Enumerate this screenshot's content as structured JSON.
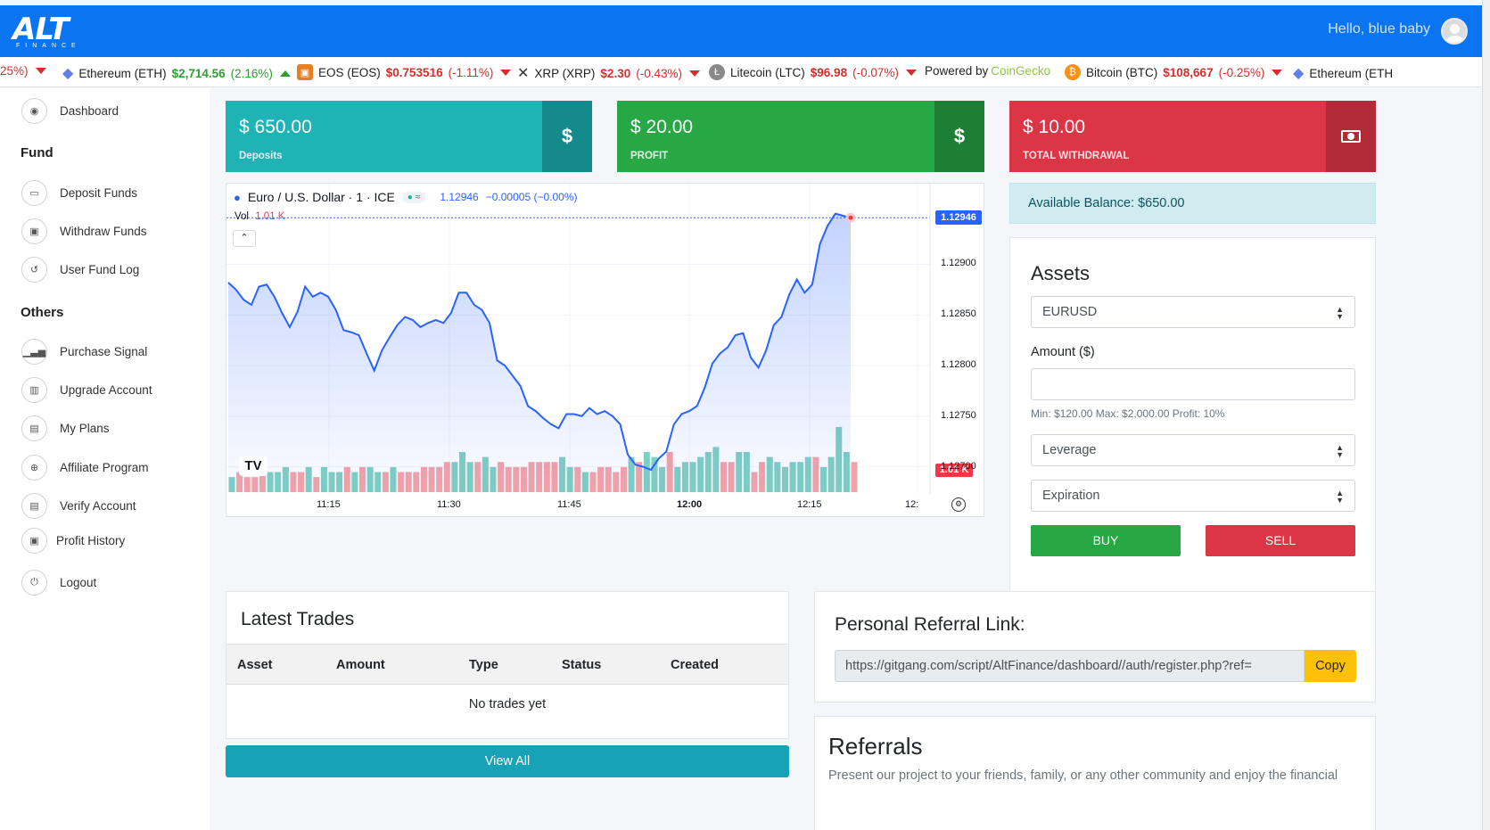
{
  "header": {
    "logo_main": "ALT",
    "logo_sub": "FINANCE",
    "greeting": "Hello, blue baby"
  },
  "ticker": [
    {
      "name": "",
      "price": "",
      "change": "25%)",
      "dir": "down",
      "icon": "none"
    },
    {
      "name": "Ethereum (ETH)",
      "price": "$2,714.56",
      "change": "(2.16%)",
      "dir": "up",
      "icon": "ethereum-icon"
    },
    {
      "name": "EOS (EOS)",
      "price": "$0.753516",
      "change": "(-1.11%)",
      "dir": "down",
      "icon": "eos-icon"
    },
    {
      "name": "XRP (XRP)",
      "price": "$2.30",
      "change": "(-0.43%)",
      "dir": "down",
      "icon": "xrp-icon"
    },
    {
      "name": "Litecoin (LTC)",
      "price": "$96.98",
      "change": "(-0.07%)",
      "dir": "down",
      "icon": "litecoin-icon"
    },
    {
      "name": "Bitcoin (BTC)",
      "price": "$108,667",
      "change": "(-0.25%)",
      "dir": "down",
      "icon": "bitcoin-icon"
    },
    {
      "name": "Ethereum (ETH",
      "price": "",
      "change": "",
      "dir": "",
      "icon": "ethereum-icon"
    }
  ],
  "ticker_powered": {
    "prefix": "Powered by",
    "brand": "CoinGecko"
  },
  "sidebar": {
    "dashboard": "Dashboard",
    "fund_heading": "Fund",
    "deposit": "Deposit Funds",
    "withdraw": "Withdraw Funds",
    "fund_log": "User Fund Log",
    "others_heading": "Others",
    "purchase_signal": "Purchase Signal",
    "upgrade": "Upgrade Account",
    "plans": "My Plans",
    "affiliate": "Affiliate Program",
    "verify": "Verify Account",
    "profit_history": "Profit History",
    "logout": "Logout"
  },
  "stats": {
    "deposits": {
      "amount": "$ 650.00",
      "label": "Deposits",
      "color": "#1fb3b5"
    },
    "profit": {
      "amount": "$ 20.00",
      "label": "PROFIT",
      "color": "#28a745"
    },
    "withdrawal": {
      "amount": "$ 10.00",
      "label": "TOTAL WITHDRAWAL",
      "color": "#dc3545"
    }
  },
  "chart_widget": {
    "symbol": "Euro / U.S. Dollar · 1 · ICE",
    "last": "1.12946",
    "change": "−0.00005 (−0.00%)",
    "vol_label": "Vol",
    "vol_value": "1.01 K",
    "price_tag": "1.12946",
    "vol_tag": "1.01 K",
    "y_ticks": [
      "1.12900",
      "1.12850",
      "1.12800",
      "1.12750",
      "1.12700"
    ],
    "x_ticks": [
      "11:15",
      "11:30",
      "11:45",
      "12:00",
      "12:15",
      "12:"
    ]
  },
  "chart_data": {
    "type": "area",
    "title": "Euro / U.S. Dollar · 1 · ICE",
    "ylim": [
      1.12675,
      1.12955
    ],
    "y_ticks": [
      1.129,
      1.1285,
      1.128,
      1.1275,
      1.127
    ],
    "x_ticks": [
      "11:15",
      "11:30",
      "11:45",
      "12:00",
      "12:15"
    ],
    "price": [
      1.12882,
      1.12875,
      1.12865,
      1.1286,
      1.12878,
      1.1288,
      1.12868,
      1.12852,
      1.12838,
      1.12853,
      1.12878,
      1.12868,
      1.12872,
      1.12868,
      1.12855,
      1.12835,
      1.12833,
      1.1283,
      1.12812,
      1.12795,
      1.12815,
      1.12828,
      1.1284,
      1.12848,
      1.12845,
      1.12838,
      1.12842,
      1.12845,
      1.12842,
      1.12852,
      1.12872,
      1.12872,
      1.1286,
      1.12855,
      1.12842,
      1.12805,
      1.128,
      1.1279,
      1.1278,
      1.1276,
      1.12755,
      1.12748,
      1.12742,
      1.12738,
      1.12752,
      1.12752,
      1.1275,
      1.12758,
      1.12752,
      1.12755,
      1.1275,
      1.12742,
      1.12712,
      1.12702,
      1.127,
      1.12697,
      1.12708,
      1.12715,
      1.12742,
      1.12752,
      1.12755,
      1.1276,
      1.12778,
      1.12802,
      1.12812,
      1.12818,
      1.1283,
      1.12832,
      1.12808,
      1.12798,
      1.12815,
      1.1284,
      1.12848,
      1.1287,
      1.12885,
      1.12872,
      1.1288,
      1.1292,
      1.12938,
      1.1295,
      1.12948,
      1.12946
    ],
    "volume_up": [
      true,
      false,
      false,
      false,
      false,
      true,
      true,
      true,
      false,
      false,
      true,
      false,
      true,
      true,
      true,
      false,
      true,
      false,
      true,
      true,
      false,
      true,
      false,
      false,
      false,
      false,
      false,
      false,
      false,
      true,
      true,
      true,
      false,
      true,
      true,
      false,
      false,
      false,
      false,
      false,
      false,
      false,
      false,
      true,
      true,
      false,
      true,
      false,
      false,
      false,
      false,
      false,
      true,
      false,
      true,
      true,
      true,
      false,
      true,
      true,
      true,
      true,
      true,
      true,
      false,
      false,
      true,
      true,
      false,
      false,
      true,
      true,
      true,
      true,
      true,
      true,
      false,
      true,
      true,
      true,
      true,
      false
    ],
    "volume": [
      3,
      4,
      3,
      3,
      4,
      4,
      4,
      5,
      4,
      4,
      5,
      3,
      5,
      4,
      4,
      5,
      4,
      5,
      5,
      4,
      4,
      5,
      4,
      4,
      4,
      5,
      5,
      5,
      6,
      6,
      8,
      6,
      6,
      7,
      5,
      6,
      5,
      5,
      5,
      6,
      6,
      6,
      6,
      7,
      5,
      5,
      4,
      4,
      5,
      5,
      4,
      5,
      7,
      6,
      8,
      7,
      5,
      8,
      5,
      6,
      6,
      7,
      8,
      9,
      6,
      6,
      8,
      8,
      4,
      6,
      7,
      6,
      5,
      6,
      6,
      7,
      7,
      5,
      7,
      13,
      8,
      6
    ]
  },
  "balance": {
    "label": "Available Balance: $650.00"
  },
  "assets_form": {
    "title": "Assets",
    "asset_value": "EURUSD",
    "amount_label": "Amount ($)",
    "amount_placeholder": "",
    "hint": "Min: $120.00 Max: $2,000.00 Profit: 10%",
    "leverage": "Leverage",
    "expiration": "Expiration",
    "buy": "BUY",
    "sell": "SELL"
  },
  "trades": {
    "title": "Latest Trades",
    "columns": [
      "Asset",
      "Amount",
      "Type",
      "Status",
      "Created"
    ],
    "empty": "No trades yet",
    "view_all": "View All"
  },
  "referral": {
    "title": "Personal Referral Link:",
    "link": "https://gitgang.com/script/AltFinance/dashboard//auth/register.php?ref=",
    "copy": "Copy",
    "ref_title": "Referrals",
    "ref_text": "Present our project to your friends, family, or any other community and enjoy the financial"
  },
  "colors": {
    "topbar": "#0b74f0",
    "up": "#2e9e2e",
    "down": "#d32f2f",
    "teal": "#17a2b8",
    "line": "#2962ff"
  }
}
